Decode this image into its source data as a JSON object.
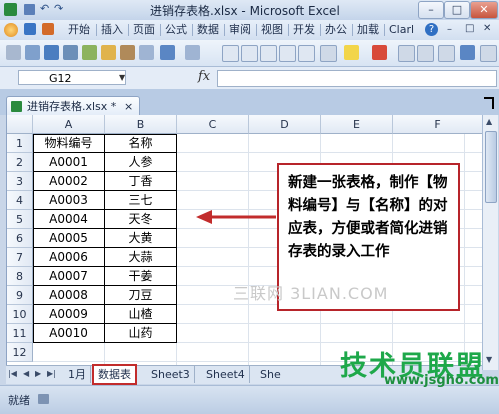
{
  "window": {
    "title": "进销存表格.xlsx - Microsoft Excel",
    "controls": {
      "minimize": "–",
      "maximize": "□",
      "close": "✕"
    }
  },
  "ribbon_tabs": [
    "开始",
    "插入",
    "页面",
    "公式",
    "数据",
    "审阅",
    "视图",
    "开发",
    "办公",
    "加载",
    "Clarl"
  ],
  "formula_bar": {
    "name_box": "G12",
    "fx": "fx",
    "formula": ""
  },
  "document_tab": {
    "label": "进销存表格.xlsx *",
    "close": "×"
  },
  "columns": [
    "A",
    "B",
    "C",
    "D",
    "E",
    "F"
  ],
  "rows": [
    "1",
    "2",
    "3",
    "4",
    "5",
    "6",
    "7",
    "8",
    "9",
    "10",
    "11",
    "12"
  ],
  "table": {
    "rows": [
      [
        "物料编号",
        "名称"
      ],
      [
        "A0001",
        "人参"
      ],
      [
        "A0002",
        "丁香"
      ],
      [
        "A0003",
        "三七"
      ],
      [
        "A0004",
        "天冬"
      ],
      [
        "A0005",
        "大黄"
      ],
      [
        "A0006",
        "大蒜"
      ],
      [
        "A0007",
        "干姜"
      ],
      [
        "A0008",
        "刀豆"
      ],
      [
        "A0009",
        "山楂"
      ],
      [
        "A0010",
        "山药"
      ]
    ]
  },
  "sheet_tabs": {
    "first": "1月",
    "active": "数据表",
    "others": [
      "Sheet3",
      "Sheet4",
      "She"
    ]
  },
  "status": "就绪",
  "annotation": {
    "text": "新建一张表格，制作【物料编号】与【名称】的对应表，方便或者简化进销存表的录入工作",
    "color": "#b7242a"
  },
  "watermarks": {
    "mark1": "三联网 3LIAN.COM",
    "mark2": "技术员联盟",
    "mark3": "www.jsgho.com"
  }
}
